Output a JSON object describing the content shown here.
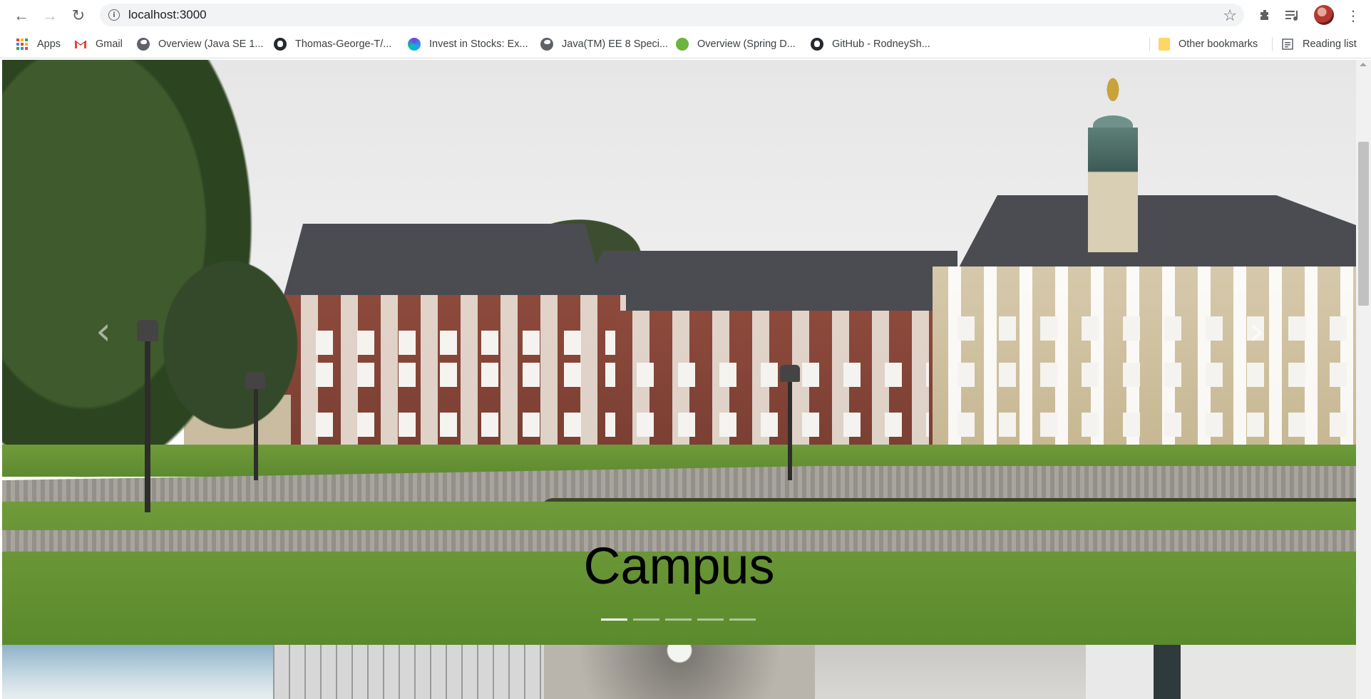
{
  "browser": {
    "url": "localhost:3000",
    "bookmarks": [
      {
        "label": "Apps",
        "icon": "apps-icon"
      },
      {
        "label": "Gmail",
        "icon": "gmail-icon"
      },
      {
        "label": "Overview (Java SE 1...",
        "icon": "globe-icon"
      },
      {
        "label": "Thomas-George-T/...",
        "icon": "github-icon"
      },
      {
        "label": "Invest in Stocks: Ex...",
        "icon": "invest-icon"
      },
      {
        "label": "Java(TM) EE 8 Speci...",
        "icon": "globe-icon"
      },
      {
        "label": "Overview (Spring D...",
        "icon": "spring-icon"
      },
      {
        "label": "GitHub - RodneySh...",
        "icon": "github-icon"
      }
    ],
    "other_bookmarks": "Other bookmarks",
    "reading_list": "Reading list"
  },
  "carousel": {
    "caption": "Campus",
    "slide_count": 5,
    "active_index": 0,
    "prev_icon": "chevron-left-icon",
    "next_icon": "chevron-right-icon"
  },
  "thumbnails": {
    "count": 5,
    "colors": [
      "#8fb3c8",
      "#9a9a9a",
      "#7d7a74",
      "#c9c8c4",
      "#2f3a3c"
    ]
  }
}
